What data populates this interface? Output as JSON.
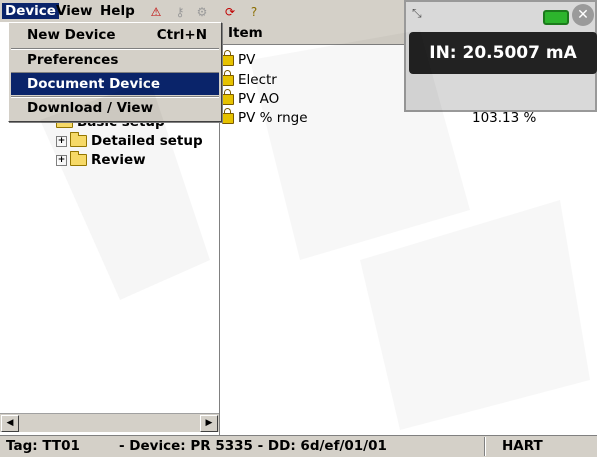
{
  "menubar": {
    "menus": [
      "Device",
      "View",
      "Help"
    ],
    "toolbar_icons": [
      "device-status-icon",
      "key-icon",
      "wrench-icon",
      "refresh-icon",
      "help-icon"
    ]
  },
  "device_menu": {
    "items": [
      {
        "label": "New Device",
        "shortcut": "Ctrl+N"
      },
      {
        "label": "Preferences"
      },
      {
        "label": "Document Device",
        "highlighted": true
      },
      {
        "label": "Download / View"
      }
    ]
  },
  "tree": {
    "items": [
      {
        "label": "Basic setup"
      },
      {
        "label": "Detailed setup"
      },
      {
        "label": "Review"
      }
    ]
  },
  "list": {
    "column_header": "Item",
    "rows": [
      {
        "label": "PV",
        "value": ""
      },
      {
        "label": "Electr",
        "value": ""
      },
      {
        "label": "PV AO",
        "value": ""
      },
      {
        "label": "PV % rnge",
        "value": "103.13 %"
      }
    ]
  },
  "overlay": {
    "reading": "IN: 20.5007 mA",
    "battery_color": "#2db52d"
  },
  "status": {
    "tag": "Tag: TT01",
    "device": "- Device: PR 5335 - DD: 6d/ef/01/01",
    "protocol": "HART"
  },
  "colors": {
    "menu_highlight": "#0a246a",
    "chrome": "#d4d0c8"
  }
}
